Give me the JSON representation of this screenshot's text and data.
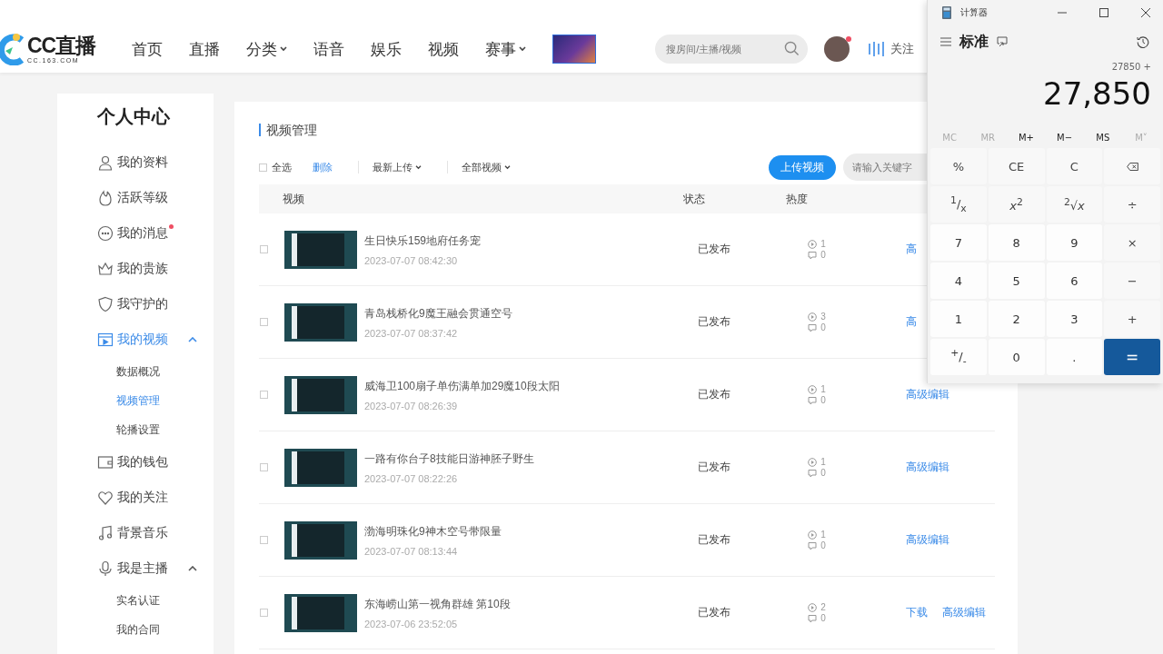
{
  "header": {
    "logo": {
      "name": "CC直播",
      "domain": "CC.163.COM"
    },
    "nav": [
      {
        "label": "首页",
        "dropdown": false
      },
      {
        "label": "直播",
        "dropdown": false
      },
      {
        "label": "分类",
        "dropdown": true
      },
      {
        "label": "语音",
        "dropdown": false
      },
      {
        "label": "娱乐",
        "dropdown": false
      },
      {
        "label": "视频",
        "dropdown": false
      },
      {
        "label": "赛事",
        "dropdown": true
      }
    ],
    "search": {
      "placeholder": "搜房间/主播/视频"
    },
    "avatar": {
      "unread": true
    },
    "follow": {
      "label": "关注"
    }
  },
  "sidebar": {
    "title": "个人中心",
    "items": [
      {
        "label": "我的资料",
        "selected": false,
        "unread": false
      },
      {
        "label": "活跃等级",
        "selected": false,
        "unread": false
      },
      {
        "label": "我的消息",
        "selected": false,
        "unread": true
      },
      {
        "label": "我的贵族",
        "selected": false,
        "unread": false
      },
      {
        "label": "我守护的",
        "selected": false,
        "unread": false
      },
      {
        "label": "我的视频",
        "selected": true,
        "unread": false,
        "expanded": true,
        "children": [
          {
            "label": "数据概况",
            "selected": false
          },
          {
            "label": "视频管理",
            "selected": true
          },
          {
            "label": "轮播设置",
            "selected": false
          }
        ]
      },
      {
        "label": "我的钱包",
        "selected": false,
        "unread": false
      },
      {
        "label": "我的关注",
        "selected": false,
        "unread": false
      },
      {
        "label": "背景音乐",
        "selected": false,
        "unread": false
      },
      {
        "label": "我是主播",
        "selected": false,
        "unread": false,
        "expanded": true,
        "children": [
          {
            "label": "实名认证",
            "selected": false
          },
          {
            "label": "我的合同",
            "selected": false
          }
        ]
      }
    ]
  },
  "panel": {
    "title": "视频管理",
    "select_all": {
      "label": "全选",
      "checked": false
    },
    "delete_label": "删除",
    "filters": [
      {
        "label": "最新上传"
      },
      {
        "label": "全部视频"
      }
    ],
    "upload_button": "上传视频",
    "search": {
      "placeholder": "请输入关键字"
    },
    "columns": [
      "视频",
      "状态",
      "热度"
    ],
    "rows": [
      {
        "checked": false,
        "title": "生日快乐159地府任务宠",
        "date": "2023-07-07 08:42:30",
        "status": "已发布",
        "plays": "1",
        "comments": "0",
        "actions": [
          "高"
        ]
      },
      {
        "checked": false,
        "title": "青岛栈桥化9魔王融会贯通空号",
        "date": "2023-07-07 08:37:42",
        "status": "已发布",
        "plays": "3",
        "comments": "0",
        "actions": [
          "高"
        ]
      },
      {
        "checked": false,
        "title": "威海卫100扇子单伤满单加29魔10段太阳",
        "date": "2023-07-07 08:26:39",
        "status": "已发布",
        "plays": "1",
        "comments": "0",
        "actions": [
          "高级编辑"
        ]
      },
      {
        "checked": false,
        "title": "一路有你台子8技能日游神胚子野生",
        "date": "2023-07-07 08:22:26",
        "status": "已发布",
        "plays": "1",
        "comments": "0",
        "actions": [
          "高级编辑"
        ]
      },
      {
        "checked": false,
        "title": "渤海明珠化9神木空号带限量",
        "date": "2023-07-07 08:13:44",
        "status": "已发布",
        "plays": "1",
        "comments": "0",
        "actions": [
          "高级编辑"
        ]
      },
      {
        "checked": false,
        "title": "东海崂山第一视角群雄 第10段",
        "date": "2023-07-06 23:52:05",
        "status": "已发布",
        "plays": "2",
        "comments": "0",
        "actions": [
          "下载",
          "高级编辑"
        ]
      }
    ]
  },
  "calculator": {
    "title": "计算器",
    "mode": "标准",
    "expression": "27850 +",
    "display": "27,850",
    "memory": [
      {
        "label": "MC",
        "disabled": true
      },
      {
        "label": "MR",
        "disabled": true
      },
      {
        "label": "M+",
        "disabled": false
      },
      {
        "label": "M−",
        "disabled": false
      },
      {
        "label": "MS",
        "disabled": false
      },
      {
        "label": "M˅",
        "disabled": true
      }
    ],
    "keys": [
      {
        "label": "%",
        "kind": "op"
      },
      {
        "label": "CE",
        "kind": "op"
      },
      {
        "label": "C",
        "kind": "op"
      },
      {
        "kind": "backspace"
      },
      {
        "label": "$^{1}$/$_{x}$",
        "kind": "op"
      },
      {
        "label": "*x*$^{2}$",
        "kind": "op"
      },
      {
        "label": "$^{2}$√*x*",
        "kind": "op"
      },
      {
        "label": "÷",
        "kind": "op"
      },
      {
        "label": "7",
        "kind": "num"
      },
      {
        "label": "8",
        "kind": "num"
      },
      {
        "label": "9",
        "kind": "num"
      },
      {
        "label": "×",
        "kind": "op"
      },
      {
        "label": "4",
        "kind": "num"
      },
      {
        "label": "5",
        "kind": "num"
      },
      {
        "label": "6",
        "kind": "num"
      },
      {
        "label": "−",
        "kind": "op"
      },
      {
        "label": "1",
        "kind": "num"
      },
      {
        "label": "2",
        "kind": "num"
      },
      {
        "label": "3",
        "kind": "num"
      },
      {
        "label": "+",
        "kind": "op"
      },
      {
        "label": "$^{+}$/$_{-}$",
        "kind": "num"
      },
      {
        "label": "0",
        "kind": "num"
      },
      {
        "label": ".",
        "kind": "num"
      },
      {
        "label": "=",
        "kind": "equals"
      }
    ]
  }
}
